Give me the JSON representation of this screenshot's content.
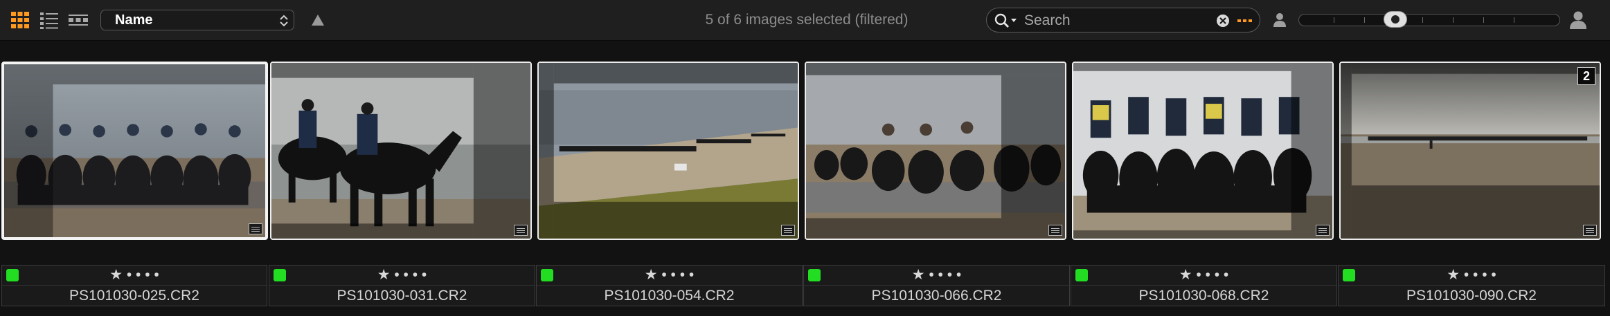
{
  "toolbar": {
    "view_modes": [
      "grid-view",
      "list-view",
      "filmstrip-view"
    ],
    "sort": {
      "selected": "Name"
    },
    "status": "5 of 6 images selected (filtered)",
    "search": {
      "placeholder": "Search",
      "value": ""
    },
    "accent_color": "#ff9a1f"
  },
  "thumbnails": [
    {
      "filename": "PS101030-025.CR2",
      "selected": true,
      "color_label": "#22dd22",
      "stars": "★ • • • •"
    },
    {
      "filename": "PS101030-031.CR2",
      "selected": false,
      "color_label": "#22dd22",
      "stars": "★ • • • •"
    },
    {
      "filename": "PS101030-054.CR2",
      "selected": false,
      "color_label": "#22dd22",
      "stars": "★ • • • •"
    },
    {
      "filename": "PS101030-066.CR2",
      "selected": false,
      "color_label": "#22dd22",
      "stars": "★ • • • •"
    },
    {
      "filename": "PS101030-068.CR2",
      "selected": false,
      "color_label": "#22dd22",
      "stars": "★ • • • •"
    },
    {
      "filename": "PS101030-090.CR2",
      "selected": false,
      "color_label": "#22dd22",
      "stars": "★ • • • •",
      "badge": "2"
    }
  ]
}
